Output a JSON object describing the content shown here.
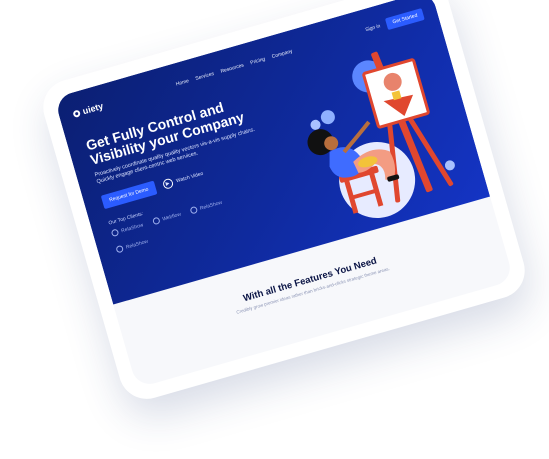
{
  "brand": {
    "name": "uiety"
  },
  "nav": {
    "items": [
      "Home",
      "Services",
      "Resources",
      "Pricing",
      "Company"
    ],
    "signin": "Sign in",
    "get_started": "Get Started"
  },
  "hero": {
    "title_line1": "Get Fully Control and",
    "title_line2": "Visibility your Company",
    "subtitle": "Proactively coordinate quality quality vectors vis-a-vis supply chains. Quickly engage client-centric web services.",
    "request_demo": "Request for Demo",
    "watch_video": "Watch Video",
    "clients_label": "Our Top Clients:",
    "clients": [
      "RelaShow",
      "Webflow",
      "RelaShow",
      "RelaShow"
    ]
  },
  "features": {
    "title": "With all the Features You Need",
    "subtitle": "Credibly grow premier ideas rather than bricks-and-clicks strategic theme areas."
  },
  "colors": {
    "hero_bg": "#0f2a9e",
    "accent": "#2b5cff"
  }
}
